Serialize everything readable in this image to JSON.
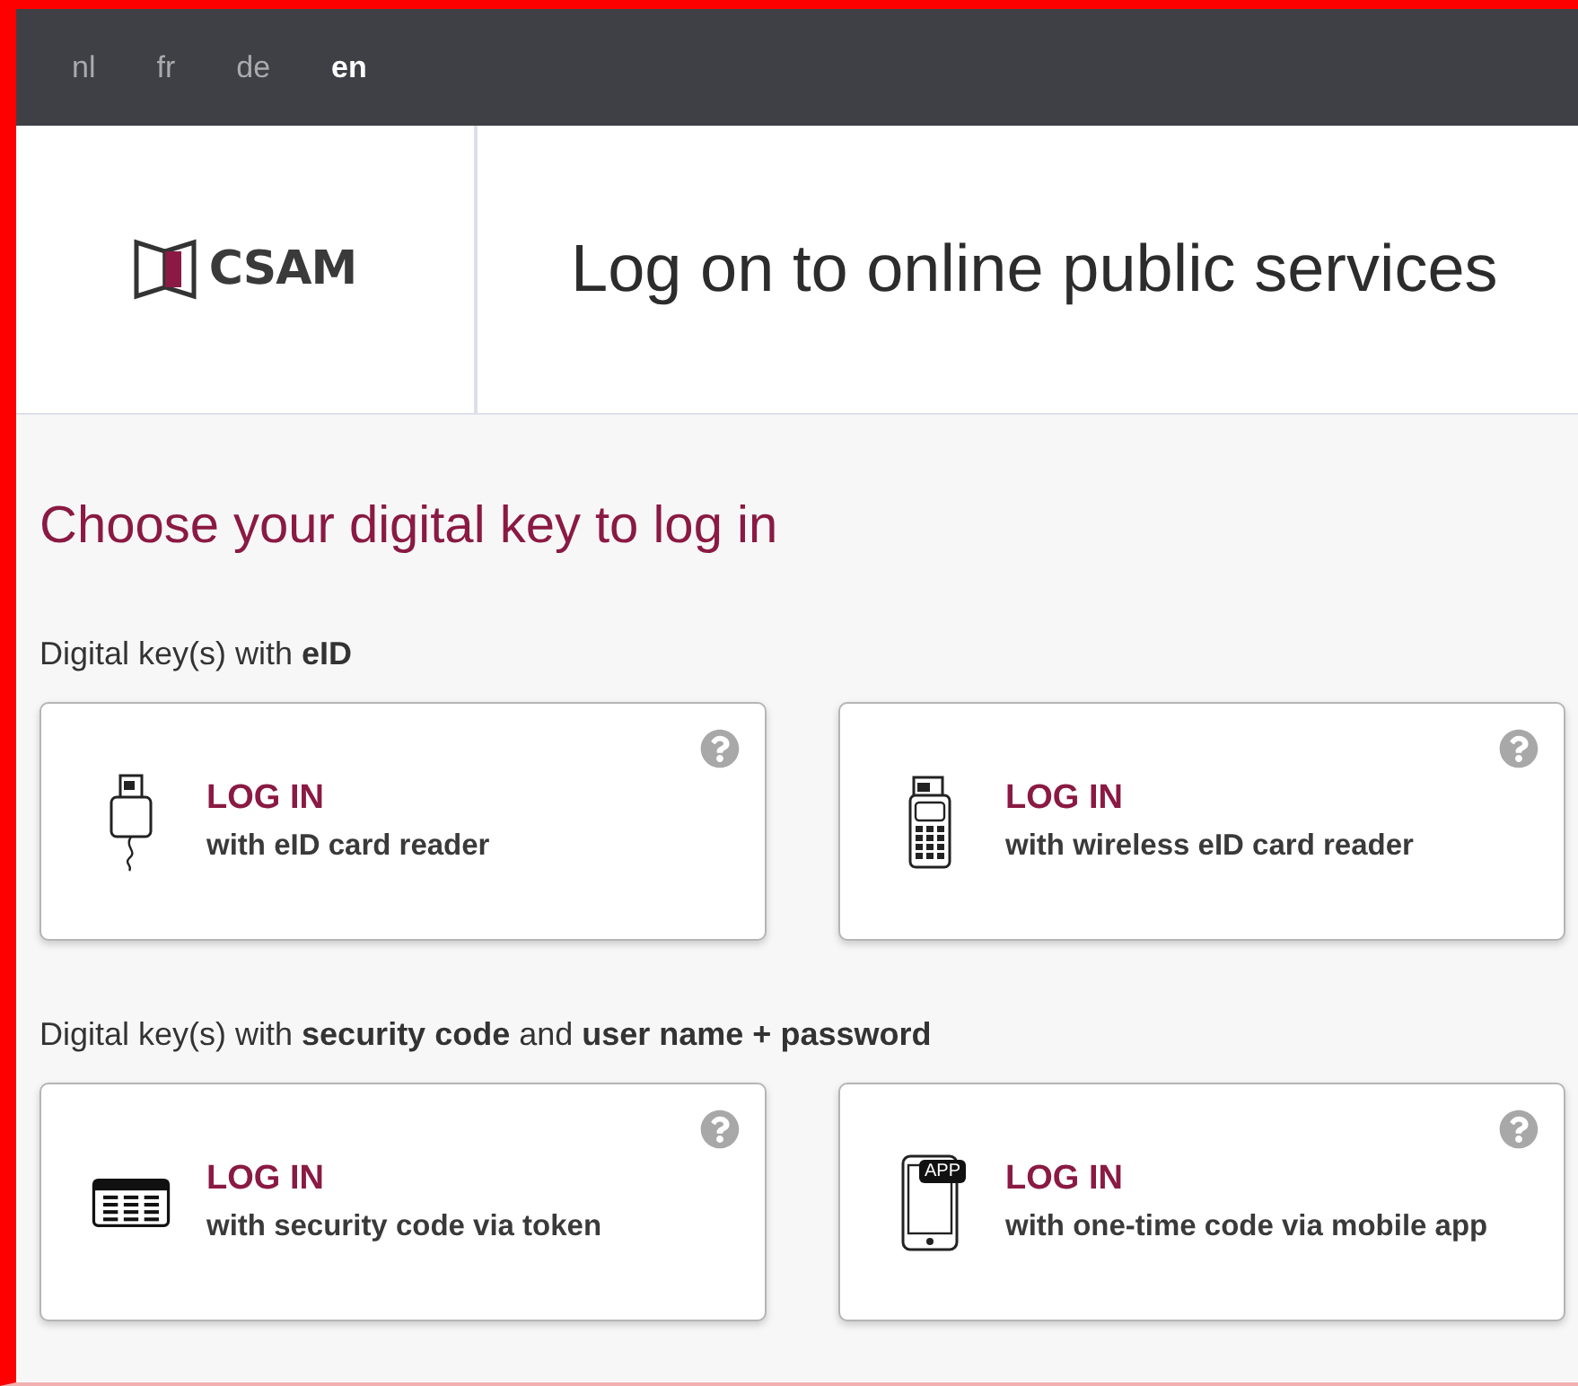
{
  "languages": [
    {
      "label": "nl",
      "selected": false
    },
    {
      "label": "fr",
      "selected": false
    },
    {
      "label": "de",
      "selected": false
    },
    {
      "label": "en",
      "selected": true
    }
  ],
  "logo": {
    "text": "CSAM"
  },
  "header": {
    "title": "Log on to online public services"
  },
  "heading": "Choose your digital key to log in",
  "sections": [
    {
      "label": "Digital key(s) with **eID**",
      "cards": [
        {
          "kind": "card-reader",
          "title": "LOG IN",
          "subtitle": "with eID card reader"
        },
        {
          "kind": "wireless-reader",
          "title": "LOG IN",
          "subtitle": "with wireless eID card reader"
        }
      ]
    },
    {
      "label": "Digital key(s) with **security code** and **user name + password**",
      "cards": [
        {
          "kind": "token",
          "title": "LOG IN",
          "subtitle": "with security code via token"
        },
        {
          "kind": "mobile-app",
          "title": "LOG IN",
          "subtitle": "with one-time code via mobile app",
          "badge": "APP"
        }
      ]
    }
  ]
}
